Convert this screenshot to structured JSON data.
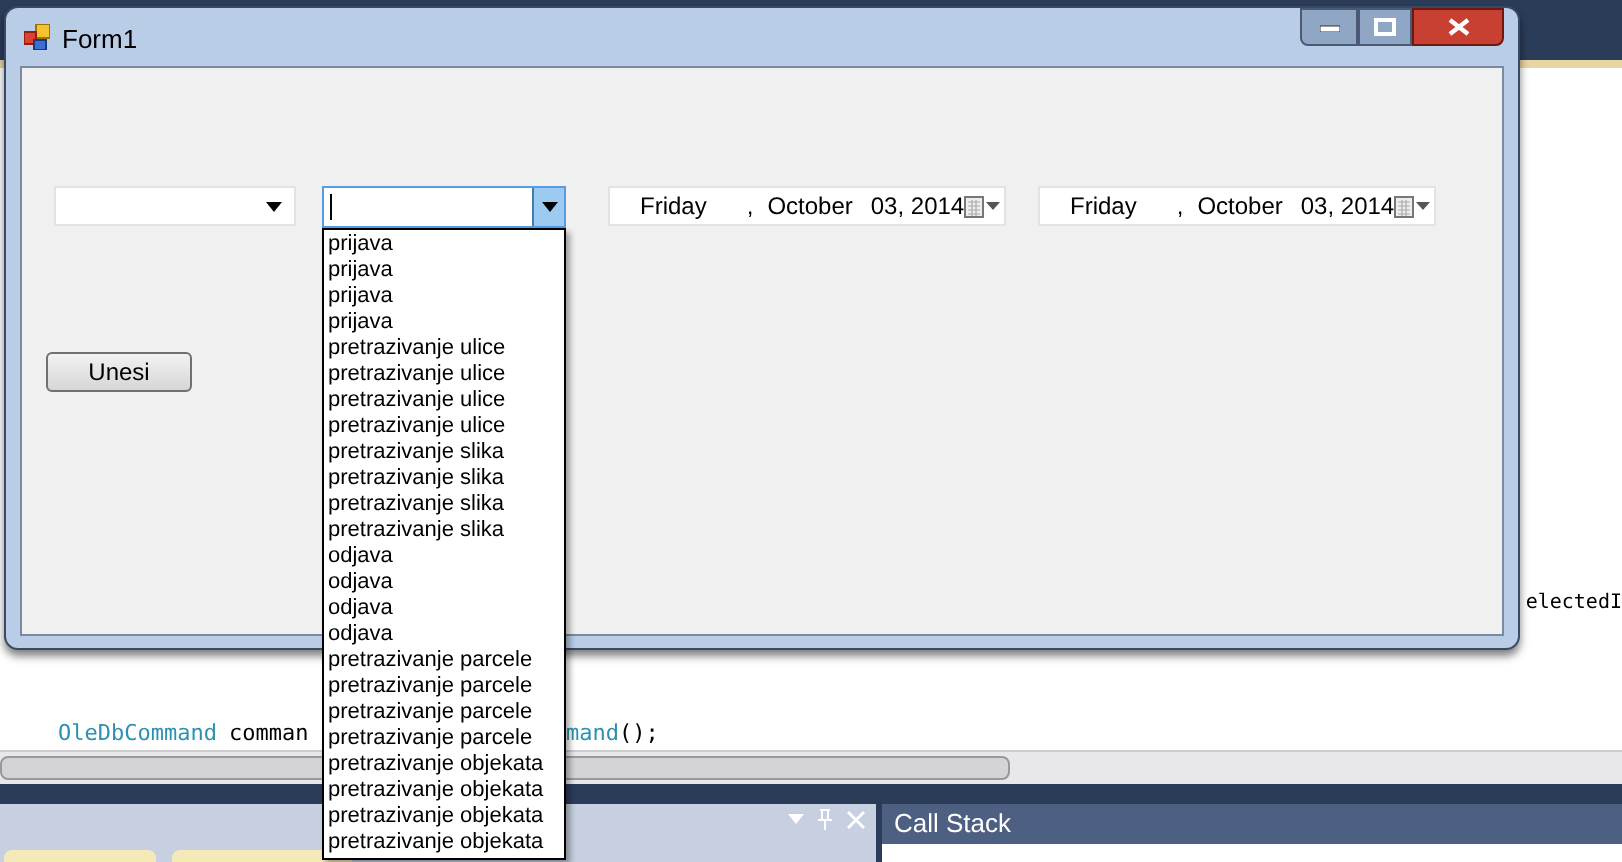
{
  "ide": {
    "code_right": "electedI",
    "code_line": [
      {
        "kind": "type",
        "text": "OleDbCommand"
      },
      {
        "kind": "plain",
        "text": "comman"
      }
    ],
    "code_line_after": [
      {
        "kind": "type",
        "text": "mand"
      },
      {
        "kind": "plain",
        "text": "();"
      }
    ],
    "panel_title": "Call Stack"
  },
  "window": {
    "title": "Form1"
  },
  "combo_1": {
    "expanded": false
  },
  "combo_2": {
    "expanded": true,
    "focused": true,
    "items": [
      "prijava",
      "prijava",
      "prijava",
      "prijava",
      "pretrazivanje ulice",
      "pretrazivanje ulice",
      "pretrazivanje ulice",
      "pretrazivanje ulice",
      "pretrazivanje slika",
      "pretrazivanje slika",
      "pretrazivanje slika",
      "pretrazivanje slika",
      "odjava",
      "odjava",
      "odjava",
      "odjava",
      "pretrazivanje parcele",
      "pretrazivanje parcele",
      "pretrazivanje parcele",
      "pretrazivanje parcele",
      "pretrazivanje objekata",
      "pretrazivanje objekata",
      "pretrazivanje objekata",
      "pretrazivanje objekata"
    ]
  },
  "date_pickers": [
    {
      "weekday": "Friday",
      "separator": ",",
      "month": "October",
      "day_year": "03, 2014"
    },
    {
      "weekday": "Friday",
      "separator": ",",
      "month": "October",
      "day_year": "03, 2014"
    }
  ],
  "button": "Unesi"
}
